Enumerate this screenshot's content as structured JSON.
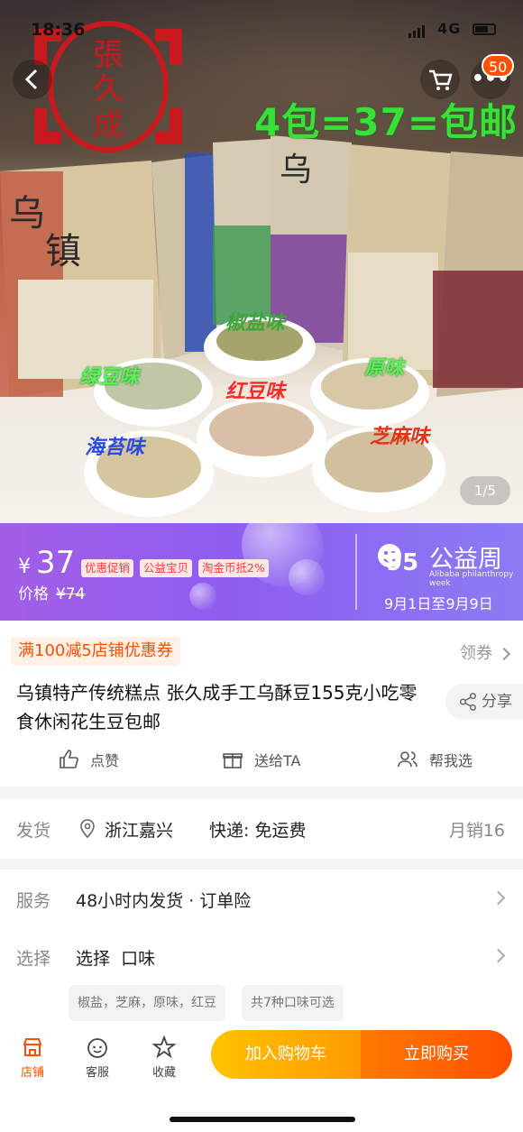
{
  "status": {
    "time": "18:36",
    "network": "4G"
  },
  "header": {
    "cart_count": "50",
    "more_label": "•••"
  },
  "hero": {
    "promo_text": "4包=37=包邮",
    "logo_text": "張久成",
    "bowl_labels": [
      "椒盐味",
      "绿豆味",
      "红豆味",
      "原味",
      "海苔味",
      "芝麻味"
    ],
    "image_counter": "1/5"
  },
  "price": {
    "currency": "¥",
    "value": "37",
    "tags": [
      "优惠促销",
      "公益宝贝",
      "淘金币抵2%"
    ],
    "original_label": "价格",
    "original_value": "¥74",
    "week_title": "公益周",
    "week_sub": "Alibaba philanthropy week",
    "week_logo_number": "95",
    "week_dates": "9月1日至9月9日"
  },
  "info": {
    "coupon": "满100减5店铺优惠券",
    "claim": "领券",
    "title": "乌镇特产传统糕点 张久成手工乌酥豆155克小吃零食休闲花生豆包邮",
    "share": "分享",
    "actions": [
      "点赞",
      "送给TA",
      "帮我选"
    ]
  },
  "delivery": {
    "label": "发货",
    "location": "浙江嘉兴",
    "express": "快递: 免运费",
    "monthly_sales": "月销16"
  },
  "service": {
    "service_label": "服务",
    "service_value": "48小时内发货 · 订单险",
    "select_label": "选择",
    "select_value": "选择  口味",
    "chips": [
      "椒盐，芝麻，原味，红豆",
      "共7种口味可选"
    ]
  },
  "bottom": {
    "nav": [
      "店铺",
      "客服",
      "收藏"
    ],
    "add_to_cart": "加入购物车",
    "buy_now": "立即购买"
  },
  "colors": {
    "accent": "#ff5000",
    "price_bg": "#9a5eea",
    "cart_btn": "#ffb000"
  }
}
